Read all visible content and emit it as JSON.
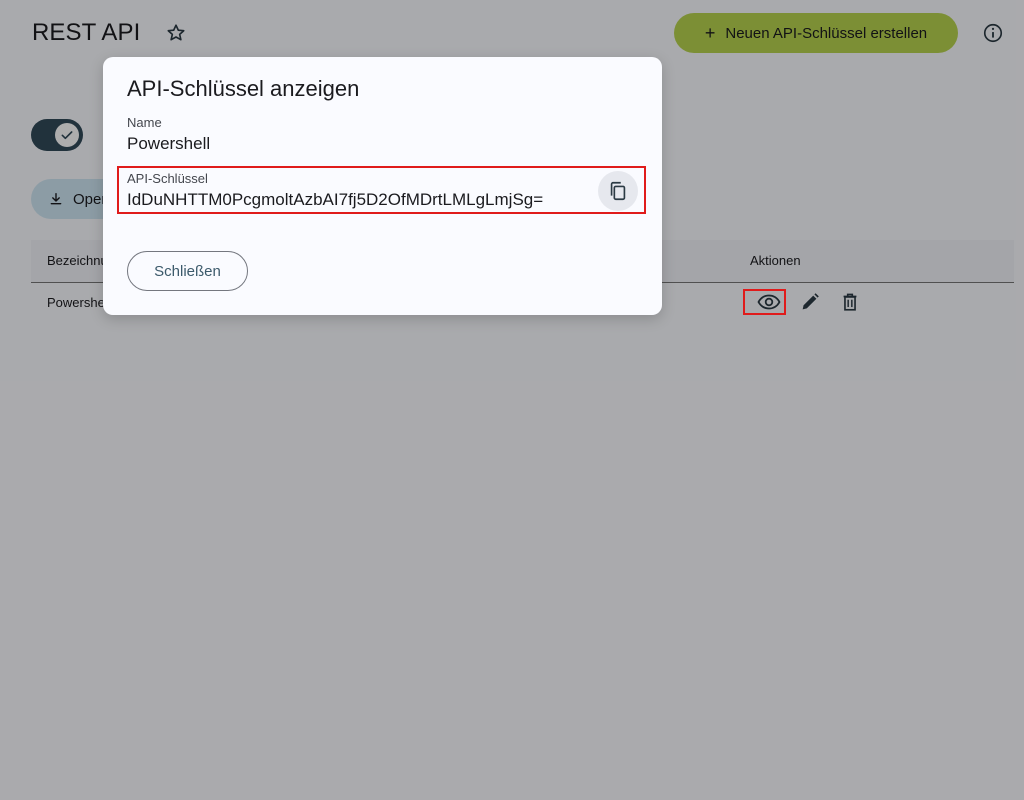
{
  "header": {
    "title": "REST API",
    "create_button_label": "Neuen API-Schlüssel erstellen",
    "plus_icon": "+"
  },
  "toolbar": {
    "openapi_button_label": "OpenAPI"
  },
  "table": {
    "columns": [
      "Bezeichnung",
      "Aktionen"
    ],
    "rows": [
      {
        "name": "Powershell"
      }
    ]
  },
  "dialog": {
    "title": "API-Schlüssel anzeigen",
    "name_label": "Name",
    "name_value": "Powershell",
    "key_label": "API-Schlüssel",
    "key_value": "IdDuNHTTM0PcgmoltAzbAI7fj5D2OfMDrtLMLgLmjSg=",
    "close_label": "Schließen"
  },
  "colors": {
    "accent_green": "#b7d34f",
    "toggle_dark": "#314a59",
    "highlight_red": "#e01b1b",
    "secondary_button": "#cfe6f4"
  },
  "icons": {
    "favorite": "star-icon",
    "info": "info-icon",
    "toggle": "check-icon",
    "download": "download-icon",
    "view": "eye-icon",
    "edit": "pencil-icon",
    "delete": "trash-icon",
    "copy": "copy-icon"
  }
}
